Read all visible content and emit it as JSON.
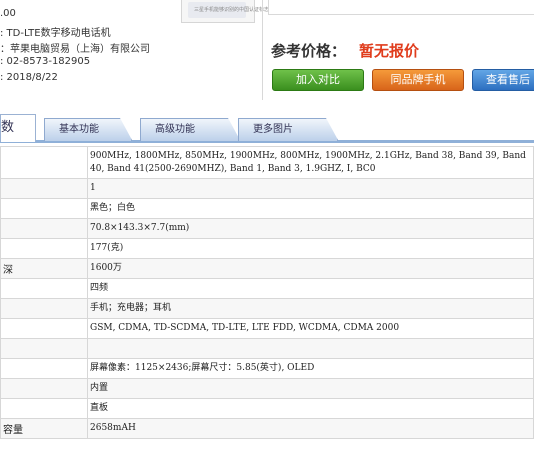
{
  "info": {
    "line1": ".00",
    "line2": ": TD-LTE数字移动电话机",
    "line3": "：苹果电脑贸易（上海）有限公司",
    "line4": ": 02-8573-182905",
    "line5": ": 2018/8/22"
  },
  "thumb_text": "三星手机能够识别的中国认证标志",
  "price": {
    "label": "参考价格：",
    "value": "暂无报价"
  },
  "buttons": {
    "compare": "加入对比",
    "same_brand": "同品牌手机",
    "after_sales": "查看售后"
  },
  "tabs": [
    {
      "label": "数"
    },
    {
      "label": "基本功能"
    },
    {
      "label": "高级功能"
    },
    {
      "label": "更多图片"
    }
  ],
  "rows": [
    {
      "label": "",
      "value": "900MHz, 1800MHz, 850MHz, 1900MHz, 800MHz, 1900MHz, 2.1GHz, Band 38, Band 39, Band 40, Band 41(2500-2690MHZ), Band 1, Band 3, 1.9GHZ, I, BC0"
    },
    {
      "label": "",
      "value": "1"
    },
    {
      "label": "",
      "value": "黑色；白色"
    },
    {
      "label": "",
      "value": "70.8×143.3×7.7(mm)"
    },
    {
      "label": "",
      "value": "177(克)"
    },
    {
      "label": "深",
      "value": "1600万"
    },
    {
      "label": "",
      "value": "四频"
    },
    {
      "label": "",
      "value": "手机；充电器；耳机"
    },
    {
      "label": "",
      "value": "GSM, CDMA, TD-SCDMA, TD-LTE, LTE FDD, WCDMA, CDMA 2000"
    },
    {
      "label": "",
      "value": ""
    },
    {
      "label": "",
      "value": "屏幕像素：1125×2436;屏幕尺寸：5.85(英寸), OLED"
    },
    {
      "label": "",
      "value": "内置"
    },
    {
      "label": "",
      "value": "直板"
    },
    {
      "label": "容量",
      "value": "2658mAH"
    }
  ]
}
